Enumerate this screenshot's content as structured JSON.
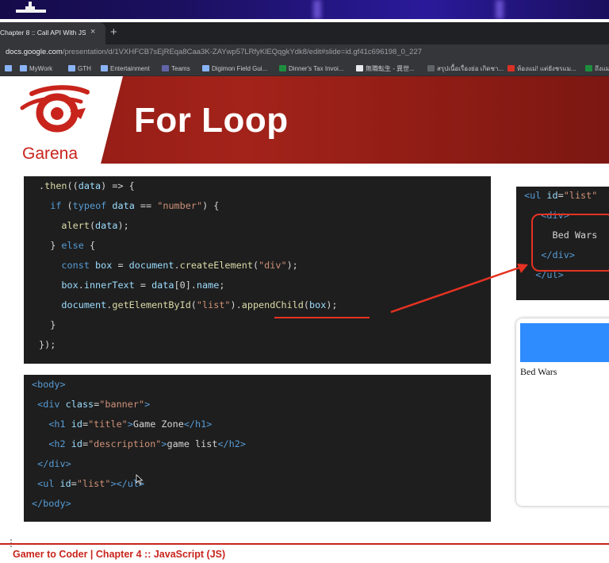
{
  "browser": {
    "tab_title": "Chapter 8 :: Call API With JS -",
    "tab_close": "×",
    "new_tab": "+",
    "url_domain": "docs.google.com",
    "url_path": "/presentation/d/1VXHFCB7sEjREqa8Caa3K-ZAYwp57LRfyKlEQqgkYdk8/edit#slide=id.gf41c696198_0_227",
    "bookmarks": [
      {
        "label": "MyWork",
        "icon": "folder-icon",
        "color": "#8ab4f8"
      },
      {
        "label": "GTH",
        "icon": "folder-icon",
        "color": "#8ab4f8"
      },
      {
        "label": "Entertainment",
        "icon": "folder-icon",
        "color": "#8ab4f8"
      },
      {
        "label": "Teams",
        "icon": "teams-icon",
        "color": "#6264a7"
      },
      {
        "label": "Digimon Field Gui...",
        "icon": "folder-icon",
        "color": "#8ab4f8"
      },
      {
        "label": "Dinner's Tax Invoi...",
        "icon": "plus-icon",
        "color": "#1e8e3e"
      },
      {
        "label": "無職転生 - 異世...",
        "icon": "globe-icon",
        "color": "#e8eaed"
      },
      {
        "label": "สรุปเนื้อเรื่องย่อ เกิดชา...",
        "icon": "page-icon",
        "color": "#5f6368"
      },
      {
        "label": "ห้องแม่! แต่ยังชรแม...",
        "icon": "page-icon",
        "color": "#d93025"
      },
      {
        "label": "ถึงแม...",
        "icon": "arrow-icon",
        "color": "#1e8e3e"
      }
    ]
  },
  "slide": {
    "logo_text": "Garena",
    "title": "For Loop",
    "accent_color": "#c8241c",
    "footer": "Gamer to Coder | Chapter 4 :: JavaScript (JS)",
    "preview_item": "Bed Wars",
    "preview_bar_color": "#2f8cff"
  },
  "code_js": [
    [
      {
        "t": ".",
        "c": "txt"
      },
      {
        "t": "then",
        "c": "fn"
      },
      {
        "t": "((",
        "c": "txt"
      },
      {
        "t": "data",
        "c": "var"
      },
      {
        "t": ") => {",
        "c": "txt"
      }
    ],
    [
      {
        "t": "  ",
        "c": "txt"
      },
      {
        "t": "if",
        "c": "kw"
      },
      {
        "t": " (",
        "c": "txt"
      },
      {
        "t": "typeof",
        "c": "kw"
      },
      {
        "t": " ",
        "c": "txt"
      },
      {
        "t": "data",
        "c": "var"
      },
      {
        "t": " == ",
        "c": "txt"
      },
      {
        "t": "\"number\"",
        "c": "str"
      },
      {
        "t": ") {",
        "c": "txt"
      }
    ],
    [
      {
        "t": "    ",
        "c": "txt"
      },
      {
        "t": "alert",
        "c": "fn"
      },
      {
        "t": "(",
        "c": "txt"
      },
      {
        "t": "data",
        "c": "var"
      },
      {
        "t": ");",
        "c": "txt"
      }
    ],
    [
      {
        "t": "  } ",
        "c": "txt"
      },
      {
        "t": "else",
        "c": "kw"
      },
      {
        "t": " {",
        "c": "txt"
      }
    ],
    [
      {
        "t": "    ",
        "c": "txt"
      },
      {
        "t": "const",
        "c": "kw"
      },
      {
        "t": " ",
        "c": "txt"
      },
      {
        "t": "box",
        "c": "var"
      },
      {
        "t": " = ",
        "c": "txt"
      },
      {
        "t": "document",
        "c": "var"
      },
      {
        "t": ".",
        "c": "txt"
      },
      {
        "t": "createElement",
        "c": "fn"
      },
      {
        "t": "(",
        "c": "txt"
      },
      {
        "t": "\"div\"",
        "c": "str"
      },
      {
        "t": ");",
        "c": "txt"
      }
    ],
    [
      {
        "t": "    ",
        "c": "txt"
      },
      {
        "t": "box",
        "c": "var"
      },
      {
        "t": ".",
        "c": "txt"
      },
      {
        "t": "innerText",
        "c": "var"
      },
      {
        "t": " = ",
        "c": "txt"
      },
      {
        "t": "data",
        "c": "var"
      },
      {
        "t": "[0].",
        "c": "txt"
      },
      {
        "t": "name",
        "c": "var"
      },
      {
        "t": ";",
        "c": "txt"
      }
    ],
    [
      {
        "t": "    ",
        "c": "txt"
      },
      {
        "t": "document",
        "c": "var"
      },
      {
        "t": ".",
        "c": "txt"
      },
      {
        "t": "getElementById",
        "c": "fn"
      },
      {
        "t": "(",
        "c": "txt"
      },
      {
        "t": "\"list\"",
        "c": "str"
      },
      {
        "t": ").",
        "c": "txt"
      },
      {
        "t": "appendChild",
        "c": "fn"
      },
      {
        "t": "(",
        "c": "txt"
      },
      {
        "t": "box",
        "c": "var"
      },
      {
        "t": ");",
        "c": "txt"
      }
    ],
    [
      {
        "t": "  }",
        "c": "txt"
      }
    ],
    [
      {
        "t": "});",
        "c": "txt"
      }
    ]
  ],
  "code_html": [
    [
      {
        "t": "<body>",
        "c": "tag"
      }
    ],
    [
      {
        "t": " ",
        "c": "txt"
      },
      {
        "t": "<div",
        "c": "tag"
      },
      {
        "t": " ",
        "c": "txt"
      },
      {
        "t": "class",
        "c": "attr"
      },
      {
        "t": "=",
        "c": "txt"
      },
      {
        "t": "\"banner\"",
        "c": "str"
      },
      {
        "t": ">",
        "c": "tag"
      }
    ],
    [
      {
        "t": "   ",
        "c": "txt"
      },
      {
        "t": "<h1",
        "c": "tag"
      },
      {
        "t": " ",
        "c": "txt"
      },
      {
        "t": "id",
        "c": "attr"
      },
      {
        "t": "=",
        "c": "txt"
      },
      {
        "t": "\"title\"",
        "c": "str"
      },
      {
        "t": ">",
        "c": "tag"
      },
      {
        "t": "Game Zone",
        "c": "txt"
      },
      {
        "t": "</h1>",
        "c": "tag"
      }
    ],
    [
      {
        "t": "   ",
        "c": "txt"
      },
      {
        "t": "<h2",
        "c": "tag"
      },
      {
        "t": " ",
        "c": "txt"
      },
      {
        "t": "id",
        "c": "attr"
      },
      {
        "t": "=",
        "c": "txt"
      },
      {
        "t": "\"description\"",
        "c": "str"
      },
      {
        "t": ">",
        "c": "tag"
      },
      {
        "t": "game list",
        "c": "txt"
      },
      {
        "t": "</h2>",
        "c": "tag"
      }
    ],
    [
      {
        "t": " ",
        "c": "txt"
      },
      {
        "t": "</div>",
        "c": "tag"
      }
    ],
    [
      {
        "t": " ",
        "c": "txt"
      },
      {
        "t": "<ul",
        "c": "tag"
      },
      {
        "t": " ",
        "c": "txt"
      },
      {
        "t": "id",
        "c": "attr"
      },
      {
        "t": "=",
        "c": "txt"
      },
      {
        "t": "\"list\"",
        "c": "str"
      },
      {
        "t": ">",
        "c": "tag"
      },
      {
        "t": "</ul>",
        "c": "tag"
      }
    ],
    [
      {
        "t": "</body>",
        "c": "tag"
      }
    ]
  ],
  "code_dom": [
    [
      {
        "t": "<ul",
        "c": "tag"
      },
      {
        "t": " ",
        "c": "txt"
      },
      {
        "t": "id",
        "c": "attr"
      },
      {
        "t": "=",
        "c": "txt"
      },
      {
        "t": "\"list\"",
        "c": "str"
      }
    ],
    [
      {
        "t": "   ",
        "c": "txt"
      },
      {
        "t": "<div>",
        "c": "tag"
      }
    ],
    [
      {
        "t": "     Bed Wars",
        "c": "txt"
      }
    ],
    [
      {
        "t": "   ",
        "c": "txt"
      },
      {
        "t": "</div>",
        "c": "tag"
      }
    ],
    [
      {
        "t": "  ",
        "c": "txt"
      },
      {
        "t": "</ul>",
        "c": "tag"
      }
    ]
  ]
}
